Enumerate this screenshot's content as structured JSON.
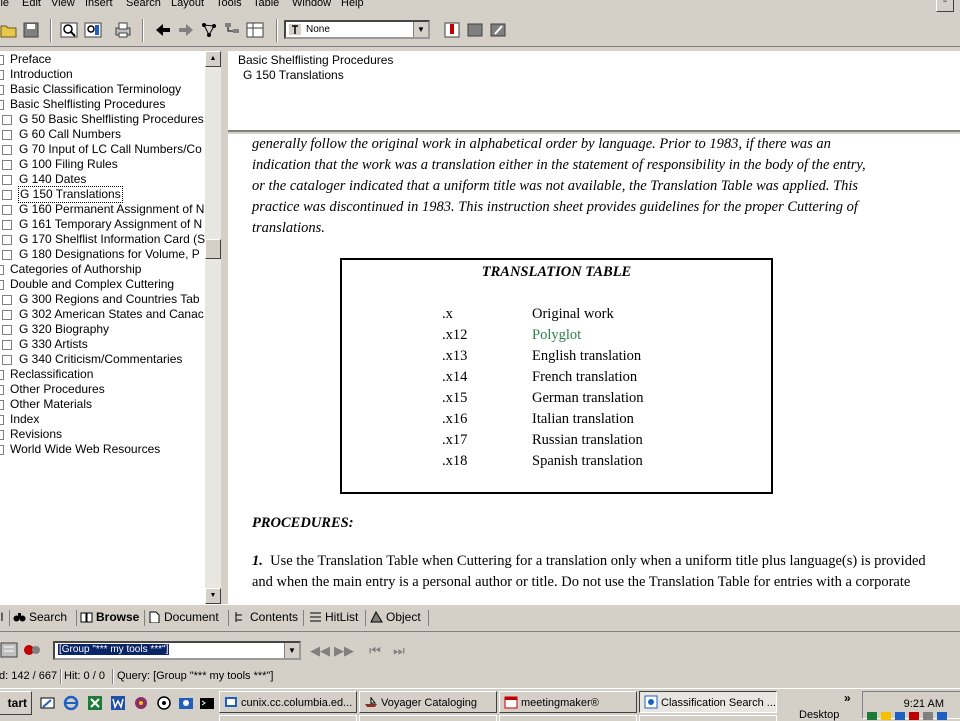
{
  "menu": [
    "ile",
    "Edit",
    "View",
    "Insert",
    "Search",
    "Layout",
    "Tools",
    "Table",
    "Window",
    "Help"
  ],
  "toolbar": {
    "style_value": "None"
  },
  "tree": [
    {
      "label": "Preface",
      "level": 0
    },
    {
      "label": "Introduction",
      "level": 0
    },
    {
      "label": "Basic Classification Terminology",
      "level": 0
    },
    {
      "label": "Basic Shelflisting Procedures",
      "level": 0
    },
    {
      "label": "G 50 Basic Shelflisting Procedures",
      "level": 1
    },
    {
      "label": "G 60 Call Numbers",
      "level": 1
    },
    {
      "label": "G 70 Input of LC Call Numbers/Co",
      "level": 1
    },
    {
      "label": "G 100 Filing Rules",
      "level": 1
    },
    {
      "label": "G 140 Dates",
      "level": 1
    },
    {
      "label": "G 150 Translations",
      "level": 1,
      "selected": true
    },
    {
      "label": "G 160 Permanent Assignment of N",
      "level": 1
    },
    {
      "label": "G 161 Temporary Assignment of N",
      "level": 1
    },
    {
      "label": "G 170 Shelflist Information Card (S",
      "level": 1
    },
    {
      "label": "G 180 Designations for Volume, P",
      "level": 1
    },
    {
      "label": "Categories of Authorship",
      "level": 0
    },
    {
      "label": "Double and Complex Cuttering",
      "level": 0
    },
    {
      "label": "G 300 Regions and Countries Tab",
      "level": 1
    },
    {
      "label": "G 302 American States and Canac",
      "level": 1
    },
    {
      "label": "G 320 Biography",
      "level": 1
    },
    {
      "label": "G 330 Artists",
      "level": 1
    },
    {
      "label": "G 340 Criticism/Commentaries",
      "level": 1
    },
    {
      "label": "Reclassification",
      "level": 0
    },
    {
      "label": "Other Procedures",
      "level": 0
    },
    {
      "label": "Other Materials",
      "level": 0
    },
    {
      "label": "Index",
      "level": 0
    },
    {
      "label": "Revisions",
      "level": 0
    },
    {
      "label": "World Wide Web Resources",
      "level": 0
    }
  ],
  "header": {
    "line1": "Basic Shelflisting Procedures",
    "line2": "G 150 Translations"
  },
  "doc": {
    "intro_lines": [
      "generally follow the original work in alphabetical order by language.  Prior to 1983, if there was an",
      "indication that the work was a translation either in the statement of responsibility in the body of the entry,",
      "or the cataloger indicated that a uniform title was not available, the Translation Table was applied.  This",
      "practice was discontinued in 1983.  This instruction sheet provides guidelines for the proper Cuttering of",
      "translations."
    ],
    "table_title": "TRANSLATION TABLE",
    "table_rows": [
      {
        "code": ".x",
        "desc": "Original work"
      },
      {
        "code": ".x12",
        "desc": "Polyglot",
        "link": true
      },
      {
        "code": ".x13",
        "desc": "English translation"
      },
      {
        "code": ".x14",
        "desc": "French translation"
      },
      {
        "code": ".x15",
        "desc": "German translation"
      },
      {
        "code": ".x16",
        "desc": "Italian translation"
      },
      {
        "code": ".x17",
        "desc": "Russian translation"
      },
      {
        "code": ".x18",
        "desc": "Spanish translation"
      }
    ],
    "procedures_heading": "PROCEDURES:",
    "proc1_num": "1.",
    "proc1_lines": [
      "  Use the Translation Table when Cuttering for a translation only when a uniform title plus language(s) is provided",
      "and when the main entry is a personal author or title.  Do not use the Translation Table for entries with a corporate"
    ]
  },
  "tabs": [
    {
      "label": "ll"
    },
    {
      "label": "Search"
    },
    {
      "label": "Browse",
      "active": true
    },
    {
      "label": "Document"
    },
    {
      "label": "Contents"
    },
    {
      "label": "HitList"
    },
    {
      "label": "Object"
    }
  ],
  "query": {
    "group_value": "[Group \"*** my tools ***\"]"
  },
  "status": {
    "record": "d: 142 / 667",
    "hits": "Hit: 0 / 0",
    "query": "Query: [Group \"*** my tools ***\"]"
  },
  "taskbar": {
    "start_label": "tart",
    "tasks": [
      {
        "label": "cunix.cc.columbia.ed..."
      },
      {
        "label": "Voyager Cataloging"
      },
      {
        "label": "meetingmaker®"
      },
      {
        "label": "Classification Search ..."
      }
    ],
    "desktop_label": "Desktop",
    "chevron": "»",
    "clock": "9:21 AM"
  },
  "colors": {
    "link": "#2e7d4f",
    "selection": "#0a246a"
  }
}
